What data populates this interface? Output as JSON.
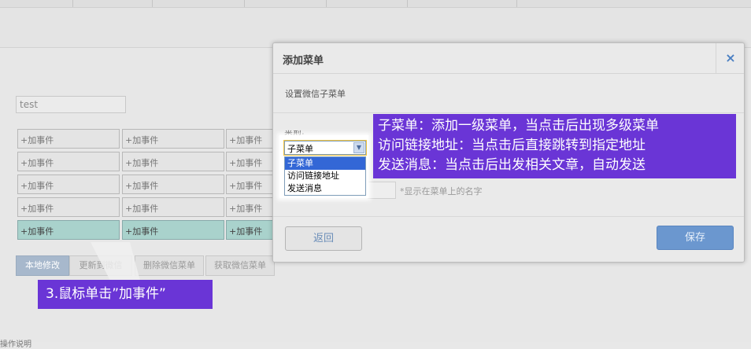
{
  "modal": {
    "title": "添加菜单",
    "close_glyph": "×",
    "subtitle": "设置微信子菜单",
    "type_label": "类型:",
    "type_select": {
      "value": "子菜单",
      "options": [
        "子菜单",
        "访问链接地址",
        "发送消息"
      ]
    },
    "name_hint": "*显示在菜单上的名字",
    "back_label": "返回",
    "save_label": "保存"
  },
  "background": {
    "menu_name_value": "test",
    "grid_rows": [
      [
        "+加事件",
        "+加事件",
        "+加事件"
      ],
      [
        "+加事件",
        "+加事件",
        "+加事件"
      ],
      [
        "+加事件",
        "+加事件",
        "+加事件"
      ],
      [
        "+加事件",
        "+加事件",
        "+加事件"
      ],
      [
        "+加事件",
        "+加事件",
        "+加事件"
      ]
    ],
    "buttons": [
      "本地修改",
      "更新到微信",
      "删除微信菜单",
      "获取微信菜单"
    ],
    "footer_text": "操作说明"
  },
  "callouts": {
    "right_lines": [
      "子菜单：添加一级菜单，当点击后出现多级菜单",
      "访问链接地址：当点击后直接跳转到指定地址",
      "发送消息：当点击后出发相关文章，自动发送"
    ],
    "bottom": "3.鼠标单击”加事件”"
  },
  "colors": {
    "callout": "#6a35d6",
    "highlight_row": "#a9d2cc",
    "save_button": "#6b97cf",
    "selected_option": "#3367d6"
  }
}
